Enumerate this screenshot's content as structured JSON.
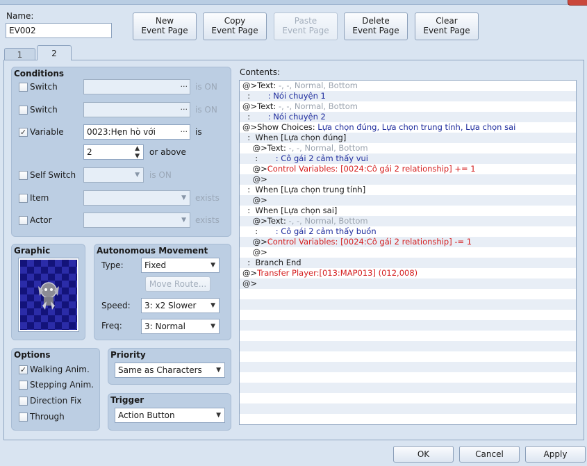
{
  "header": {
    "name_label": "Name:",
    "name_value": "EV002",
    "buttons": {
      "new": "New\nEvent Page",
      "copy": "Copy\nEvent Page",
      "paste": "Paste\nEvent Page",
      "delete": "Delete\nEvent Page",
      "clear": "Clear\nEvent Page"
    }
  },
  "tabs": [
    {
      "label": "1",
      "active": false
    },
    {
      "label": "2",
      "active": true
    }
  ],
  "conditions": {
    "title": "Conditions",
    "switch1": {
      "label": "Switch",
      "checked": false,
      "value": "",
      "suffix": "is ON"
    },
    "switch2": {
      "label": "Switch",
      "checked": false,
      "value": "",
      "suffix": "is ON"
    },
    "variable": {
      "label": "Variable",
      "checked": true,
      "value": "0023:Hẹn hò với",
      "suffix": "is",
      "amount": "2",
      "comparison": "or above"
    },
    "self_switch": {
      "label": "Self Switch",
      "checked": false,
      "value": "",
      "suffix": "is ON"
    },
    "item": {
      "label": "Item",
      "checked": false,
      "value": "",
      "suffix": "exists"
    },
    "actor": {
      "label": "Actor",
      "checked": false,
      "value": "",
      "suffix": "exists"
    }
  },
  "graphic": {
    "title": "Graphic",
    "sprite_icon": "gargoyle-sprite-icon"
  },
  "autonomous_movement": {
    "title": "Autonomous Movement",
    "type_label": "Type:",
    "type_value": "Fixed",
    "move_route_label": "Move Route...",
    "speed_label": "Speed:",
    "speed_value": "3: x2 Slower",
    "freq_label": "Freq:",
    "freq_value": "3: Normal"
  },
  "options": {
    "title": "Options",
    "items": [
      {
        "label": "Walking Anim.",
        "checked": true
      },
      {
        "label": "Stepping Anim.",
        "checked": false
      },
      {
        "label": "Direction Fix",
        "checked": false
      },
      {
        "label": "Through",
        "checked": false
      }
    ]
  },
  "priority": {
    "title": "Priority",
    "value": "Same as Characters"
  },
  "trigger": {
    "title": "Trigger",
    "value": "Action Button"
  },
  "contents": {
    "label": "Contents:",
    "lines": [
      [
        {
          "t": "@>Text: ",
          "c": "black"
        },
        {
          "t": "-, -, Normal, Bottom",
          "c": "gray"
        }
      ],
      [
        {
          "t": "  :       ",
          "c": "black"
        },
        {
          "t": ": Nói chuyện 1",
          "c": "blue"
        }
      ],
      [
        {
          "t": "@>Text: ",
          "c": "black"
        },
        {
          "t": "-, -, Normal, Bottom",
          "c": "gray"
        }
      ],
      [
        {
          "t": "  :       ",
          "c": "black"
        },
        {
          "t": ": Nói chuyện 2",
          "c": "blue"
        }
      ],
      [
        {
          "t": "@>Show Choices: ",
          "c": "black"
        },
        {
          "t": "Lựa chọn đúng, Lựa chọn trung tính, Lựa chọn sai",
          "c": "blue"
        }
      ],
      [
        {
          "t": "  :  When [Lựa chọn đúng]",
          "c": "black"
        }
      ],
      [
        {
          "t": "    @>Text: ",
          "c": "black"
        },
        {
          "t": "-, -, Normal, Bottom",
          "c": "gray"
        }
      ],
      [
        {
          "t": "     :       ",
          "c": "black"
        },
        {
          "t": ": Cô gái 2 cảm thấy vui",
          "c": "blue"
        }
      ],
      [
        {
          "t": "    @>",
          "c": "black"
        },
        {
          "t": "Control Variables: [0024:Cô gái 2 relationship] += 1",
          "c": "red"
        }
      ],
      [
        {
          "t": "    @>",
          "c": "black"
        }
      ],
      [
        {
          "t": "  :  When [Lựa chọn trung tính]",
          "c": "black"
        }
      ],
      [
        {
          "t": "    @>",
          "c": "black"
        }
      ],
      [
        {
          "t": "  :  When [Lựa chọn sai]",
          "c": "black"
        }
      ],
      [
        {
          "t": "    @>Text: ",
          "c": "black"
        },
        {
          "t": "-, -, Normal, Bottom",
          "c": "gray"
        }
      ],
      [
        {
          "t": "     :       ",
          "c": "black"
        },
        {
          "t": ": Cô gái 2 cảm thấy buồn",
          "c": "blue"
        }
      ],
      [
        {
          "t": "    @>",
          "c": "black"
        },
        {
          "t": "Control Variables: [0024:Cô gái 2 relationship] -= 1",
          "c": "red"
        }
      ],
      [
        {
          "t": "    @>",
          "c": "black"
        }
      ],
      [
        {
          "t": "  :  Branch End",
          "c": "black"
        }
      ],
      [
        {
          "t": "@>",
          "c": "black"
        },
        {
          "t": "Transfer Player:[013:MAP013] (012,008)",
          "c": "red"
        }
      ],
      [
        {
          "t": "@>",
          "c": "black"
        }
      ]
    ]
  },
  "footer": {
    "ok": "OK",
    "cancel": "Cancel",
    "apply": "Apply"
  }
}
